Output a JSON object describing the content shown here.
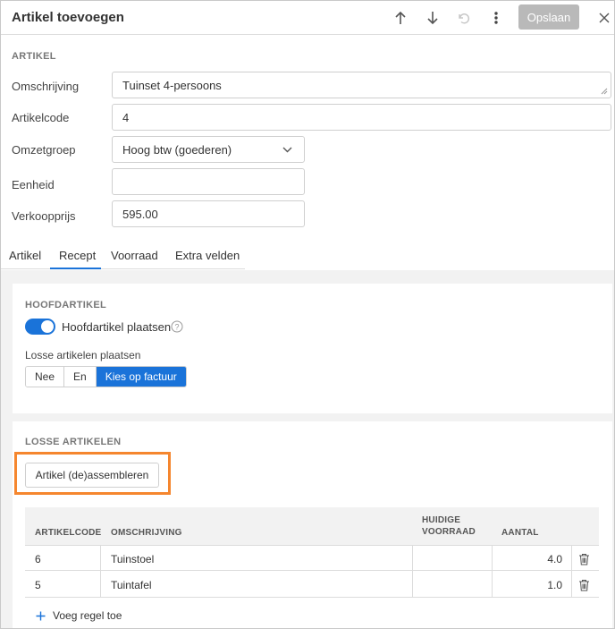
{
  "header": {
    "title": "Artikel toevoegen",
    "save_label": "Opslaan"
  },
  "artikel_section": {
    "label": "ARTIKEL",
    "fields": {
      "omschrijving": {
        "label": "Omschrijving",
        "value": "Tuinset 4-persoons"
      },
      "artikelcode": {
        "label": "Artikelcode",
        "value": "4"
      },
      "omzetgroep": {
        "label": "Omzetgroep",
        "value": "Hoog btw (goederen)"
      },
      "eenheid": {
        "label": "Eenheid",
        "value": ""
      },
      "verkoopprijs": {
        "label": "Verkoopprijs",
        "value": "595.00"
      }
    }
  },
  "tabs": [
    {
      "label": "Artikel"
    },
    {
      "label": "Recept"
    },
    {
      "label": "Voorraad"
    },
    {
      "label": "Extra velden"
    }
  ],
  "active_tab": "Recept",
  "hoofdartikel": {
    "label": "HOOFDARTIKEL",
    "toggle_label": "Hoofdartikel plaatsen",
    "toggle_on": true,
    "losse_label": "Losse artikelen plaatsen",
    "options": [
      "Nee",
      "En",
      "Kies op factuur"
    ],
    "selected_option": "Kies op factuur"
  },
  "losse_artikelen": {
    "label": "LOSSE ARTIKELEN",
    "assemble_button": "Artikel (de)assembleren",
    "columns": {
      "artikelcode": "ARTIKELCODE",
      "omschrijving": "OMSCHRIJVING",
      "huidige": "HUIDIGE",
      "voorraad": "VOORRAAD",
      "aantal": "AANTAL"
    },
    "rows": [
      {
        "artikelcode": "6",
        "omschrijving": "Tuinstoel",
        "voorraad": "",
        "aantal": "4.0"
      },
      {
        "artikelcode": "5",
        "omschrijving": "Tuintafel",
        "voorraad": "",
        "aantal": "1.0"
      }
    ],
    "add_row_label": "Voeg regel toe"
  },
  "colors": {
    "accent": "#1a73d9",
    "highlight": "#f5862e",
    "disabled_button": "#b9b9b9"
  }
}
